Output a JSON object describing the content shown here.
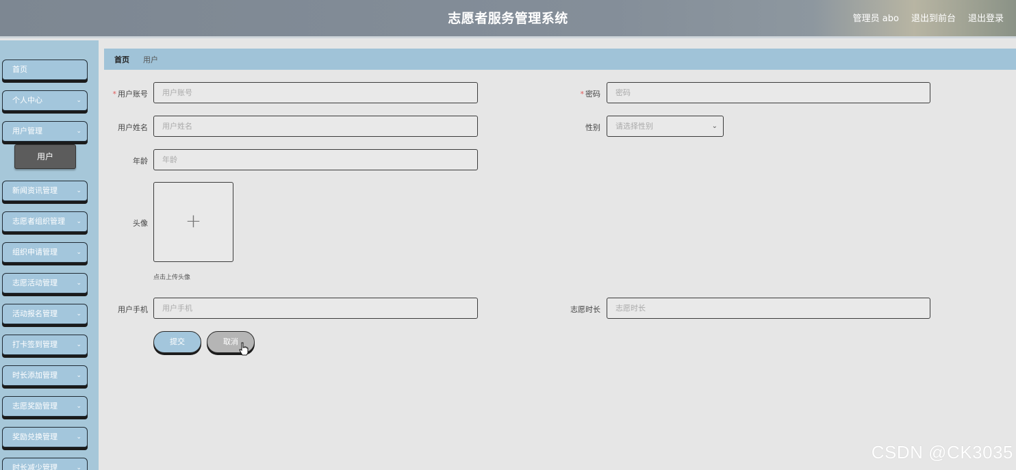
{
  "header": {
    "title": "志愿者服务管理系统",
    "admin": "管理员 abo",
    "to_front": "退出到前台",
    "logout": "退出登录"
  },
  "sidebar": {
    "items": [
      {
        "label": "首页",
        "has_children": false
      },
      {
        "label": "个人中心",
        "has_children": true
      },
      {
        "label": "用户管理",
        "has_children": true
      },
      {
        "label": "新闻资讯管理",
        "has_children": true
      },
      {
        "label": "志愿者组织管理",
        "has_children": true
      },
      {
        "label": "组织申请管理",
        "has_children": true
      },
      {
        "label": "志愿活动管理",
        "has_children": true
      },
      {
        "label": "活动报名管理",
        "has_children": true
      },
      {
        "label": "打卡签到管理",
        "has_children": true
      },
      {
        "label": "时长添加管理",
        "has_children": true
      },
      {
        "label": "志愿奖励管理",
        "has_children": true
      },
      {
        "label": "奖励兑换管理",
        "has_children": true
      },
      {
        "label": "时长减少管理",
        "has_children": true
      }
    ],
    "sub_item": "用户",
    "chevron": "⌄"
  },
  "breadcrumb": {
    "home": "首页",
    "current": "用户"
  },
  "form": {
    "account": {
      "label": "用户账号",
      "placeholder": "用户账号",
      "required": true
    },
    "password": {
      "label": "密码",
      "placeholder": "密码",
      "required": true
    },
    "name": {
      "label": "用户姓名",
      "placeholder": "用户姓名"
    },
    "gender": {
      "label": "性别",
      "placeholder": "请选择性别"
    },
    "age": {
      "label": "年龄",
      "placeholder": "年龄"
    },
    "avatar": {
      "label": "头像",
      "plus": "+",
      "tip": "点击上传头像"
    },
    "phone": {
      "label": "用户手机",
      "placeholder": "用户手机"
    },
    "hours": {
      "label": "志愿时长",
      "placeholder": "志愿时长"
    },
    "required_mark": "*",
    "submit": "提交",
    "cancel": "取消"
  },
  "watermark": "CSDN @CK3035",
  "colors": {
    "sidebar_bg": "#a6c7d9",
    "breadcrumb_bg": "#a0c3d8",
    "content_bg": "#e6e6e6",
    "active_sub": "#5c5c5c"
  }
}
